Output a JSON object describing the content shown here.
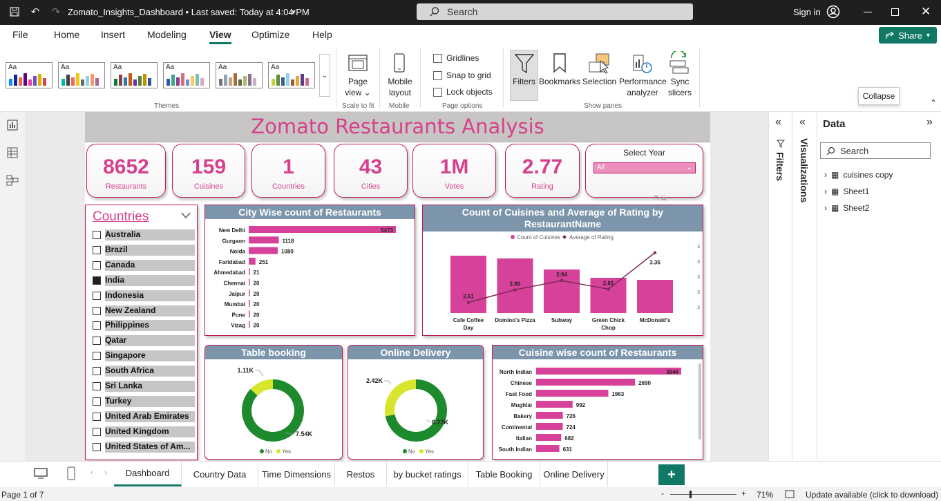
{
  "window": {
    "doc_title": "Zomato_Insights_Dashboard • Last saved: Today at 4:04 PM",
    "search_placeholder": "Search",
    "sign_in": "Sign in"
  },
  "menu": {
    "tabs": [
      "File",
      "Home",
      "Insert",
      "Modeling",
      "View",
      "Optimize",
      "Help"
    ],
    "active": "View",
    "share": "Share"
  },
  "ribbon": {
    "groups": {
      "themes": "Themes",
      "scale": "Scale to fit",
      "mobile": "Mobile",
      "page_options": "Page options",
      "show_panes": "Show panes"
    },
    "theme_tile_label": "Aa",
    "page_view": [
      "Page",
      "view"
    ],
    "mobile_layout": [
      "Mobile",
      "layout"
    ],
    "checks": [
      "Gridlines",
      "Snap to grid",
      "Lock objects"
    ],
    "panes": [
      {
        "label": [
          "Filters"
        ],
        "icon": "filter-icon"
      },
      {
        "label": [
          "Bookmarks"
        ],
        "icon": "bookmark-icon"
      },
      {
        "label": [
          "Selection"
        ],
        "icon": "selection-icon"
      },
      {
        "label": [
          "Performance",
          "analyzer"
        ],
        "icon": "performance-icon"
      },
      {
        "label": [
          "Sync",
          "slicers"
        ],
        "icon": "sync-icon"
      }
    ]
  },
  "tooltip": "Collapse",
  "report": {
    "title": "Zomato Restaurants Analysis",
    "kpis": [
      {
        "value": "8652",
        "label": "Restaurants"
      },
      {
        "value": "159",
        "label": "Cuisines"
      },
      {
        "value": "1",
        "label": "Countries"
      },
      {
        "value": "43",
        "label": "Cities"
      },
      {
        "value": "1M",
        "label": "Votes"
      },
      {
        "value": "2.77",
        "label": "Rating"
      }
    ],
    "year_slicer": {
      "title": "Select Year",
      "value": "All"
    },
    "countries_slicer": {
      "title": "Countries",
      "items": [
        "Australia",
        "Brazil",
        "Canada",
        "India",
        "Indonesia",
        "New Zealand",
        "Philippines",
        "Qatar",
        "Singapore",
        "South Africa",
        "Sri Lanka",
        "Turkey",
        "United Arab Emirates",
        "United Kingdom",
        "United States of Am..."
      ],
      "checked": "India"
    }
  },
  "chart_data": [
    {
      "type": "bar",
      "title": "City Wise count of Restaurants",
      "orientation": "horizontal",
      "categories": [
        "New Delhi",
        "Gurgaon",
        "Noida",
        "Faridabad",
        "Ahmedabad",
        "Chennai",
        "Jaipur",
        "Mumbai",
        "Pune",
        "Vizag"
      ],
      "values": [
        5473,
        1118,
        1080,
        251,
        21,
        20,
        20,
        20,
        20,
        20
      ],
      "labels": [
        "5473",
        "1118",
        "1080",
        "251",
        "21",
        "20",
        "20",
        "20",
        "20",
        "20"
      ],
      "color": "#d6419a"
    },
    {
      "type": "bar",
      "title": "Count of Cuisines and Average of Rating by RestaurantName",
      "categories": [
        "Cafe Coffee Day",
        "Domino's Pizza",
        "Subway",
        "Green Chick Chop",
        "McDonald's"
      ],
      "series": [
        {
          "name": "Count of Cuisines",
          "type": "bar",
          "values": [
            83,
            79,
            63,
            51,
            48
          ],
          "color": "#d6419a"
        },
        {
          "name": "Average of Rating",
          "type": "line",
          "values": [
            2.61,
            2.8,
            2.94,
            2.81,
            3.36
          ],
          "labels": [
            "2.61",
            "2.80",
            "2.94",
            "2.81",
            "3.36"
          ],
          "color": "#7b2a55"
        }
      ],
      "right_axis_tick": "3"
    },
    {
      "type": "pie",
      "title": "Table booking",
      "donut": true,
      "slices": [
        {
          "name": "No",
          "value": 7.54,
          "label": "7.54K",
          "color": "#1e8a2e"
        },
        {
          "name": "Yes",
          "value": 1.11,
          "label": "1.11K",
          "color": "#d7e52c"
        }
      ]
    },
    {
      "type": "pie",
      "title": "Online Delivery",
      "donut": true,
      "slices": [
        {
          "name": "No",
          "value": 6.23,
          "label": "6.23K",
          "color": "#1e8a2e"
        },
        {
          "name": "Yes",
          "value": 2.42,
          "label": "2.42K",
          "color": "#d7e52c"
        }
      ]
    },
    {
      "type": "bar",
      "title": "Cuisine wise count of Restaurants",
      "orientation": "horizontal",
      "categories": [
        "North Indian",
        "Chinese",
        "Fast Food",
        "Mughlai",
        "Bakery",
        "Continental",
        "Italian",
        "South Indian"
      ],
      "values": [
        3946,
        2690,
        1963,
        992,
        726,
        724,
        682,
        631
      ],
      "labels": [
        "3946",
        "2690",
        "1963",
        "992",
        "726",
        "724",
        "682",
        "631"
      ],
      "color": "#d6419a"
    }
  ],
  "right_panes": {
    "filters": "Filters",
    "visualizations": "Visualizations",
    "data_title": "Data",
    "data_search": "Search",
    "tables": [
      "cuisines copy",
      "Sheet1",
      "Sheet2"
    ]
  },
  "page_tabs": [
    "Dashboard",
    "Country Data",
    "Time Dimensions",
    "Restos",
    "by bucket ratings",
    "Table Booking",
    "Online Delivery"
  ],
  "active_page": "Dashboard",
  "status": {
    "page": "Page 1 of 7",
    "zoom": "71%",
    "update": "Update available (click to download)"
  }
}
